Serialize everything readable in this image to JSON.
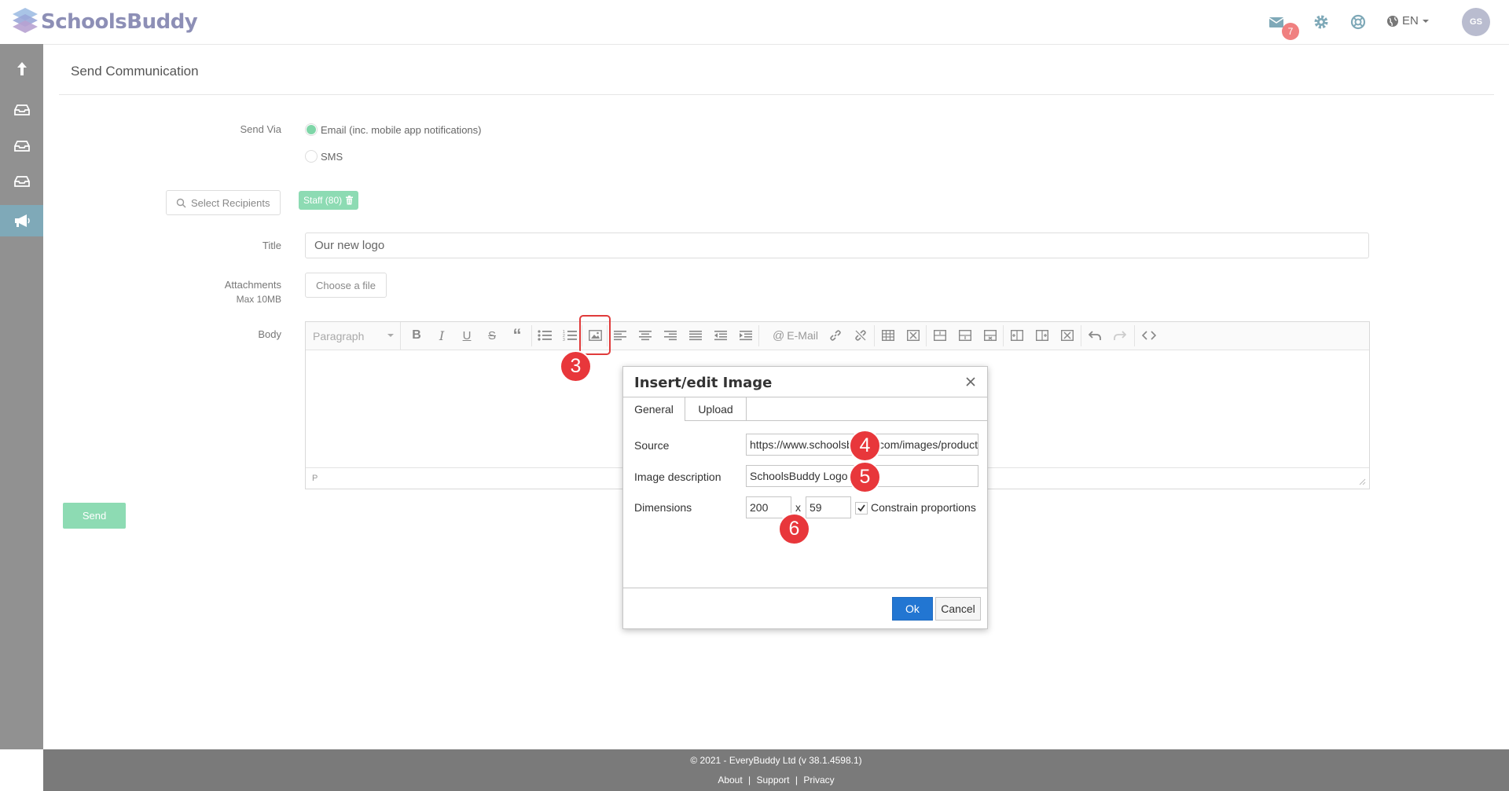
{
  "header": {
    "logo_text": "SchoolsBuddy",
    "notification_count": "7",
    "language": "EN",
    "avatar_initials": "GS"
  },
  "page": {
    "title": "Send Communication"
  },
  "form": {
    "send_via_label": "Send Via",
    "send_via_options": [
      {
        "label": "Email (inc. mobile app notifications)",
        "selected": true
      },
      {
        "label": "SMS",
        "selected": false
      }
    ],
    "select_recipients_label": "Select Recipients",
    "recipient_chip": "Staff (80)",
    "title_label": "Title",
    "title_value": "Our new logo",
    "attachments_label": "Attachments",
    "attachments_note": "Max 10MB",
    "choose_file_label": "Choose a file",
    "body_label": "Body",
    "send_label": "Send"
  },
  "editor": {
    "block_format": "Paragraph",
    "email_button": "E-Mail",
    "status_path": "P"
  },
  "dialog": {
    "title": "Insert/edit Image",
    "tabs": [
      "General",
      "Upload"
    ],
    "source_label": "Source",
    "source_value": "https://www.schoolsbuddy.com/images/products/logo.png",
    "description_label": "Image description",
    "description_value": "SchoolsBuddy Logo",
    "dimensions_label": "Dimensions",
    "width_value": "200",
    "x_label": "x",
    "height_value": "59",
    "constrain_label": "Constrain proportions",
    "constrain_checked": true,
    "ok_label": "Ok",
    "cancel_label": "Cancel"
  },
  "steps": [
    "3",
    "4",
    "5",
    "6"
  ],
  "footer": {
    "copyright": "© 2021 - EveryBuddy Ltd (v 38.1.4598.1)",
    "link_about": "About",
    "link_support": "Support",
    "link_privacy": "Privacy",
    "separator": "|"
  },
  "colors": {
    "accent_green": "#8ddbb3",
    "sidebar": "#919191",
    "sidebar_active": "#7fa9b8",
    "primary_blue": "#2276d2",
    "step_red": "#e8373b",
    "footer": "#7a7a7a"
  },
  "icons": {
    "sidebar": [
      "upload-icon",
      "inbox-icon",
      "inbox-icon",
      "inbox-icon",
      "megaphone-icon"
    ],
    "top": [
      "mail-icon",
      "gear-icon",
      "support-icon",
      "globe-icon"
    ]
  }
}
